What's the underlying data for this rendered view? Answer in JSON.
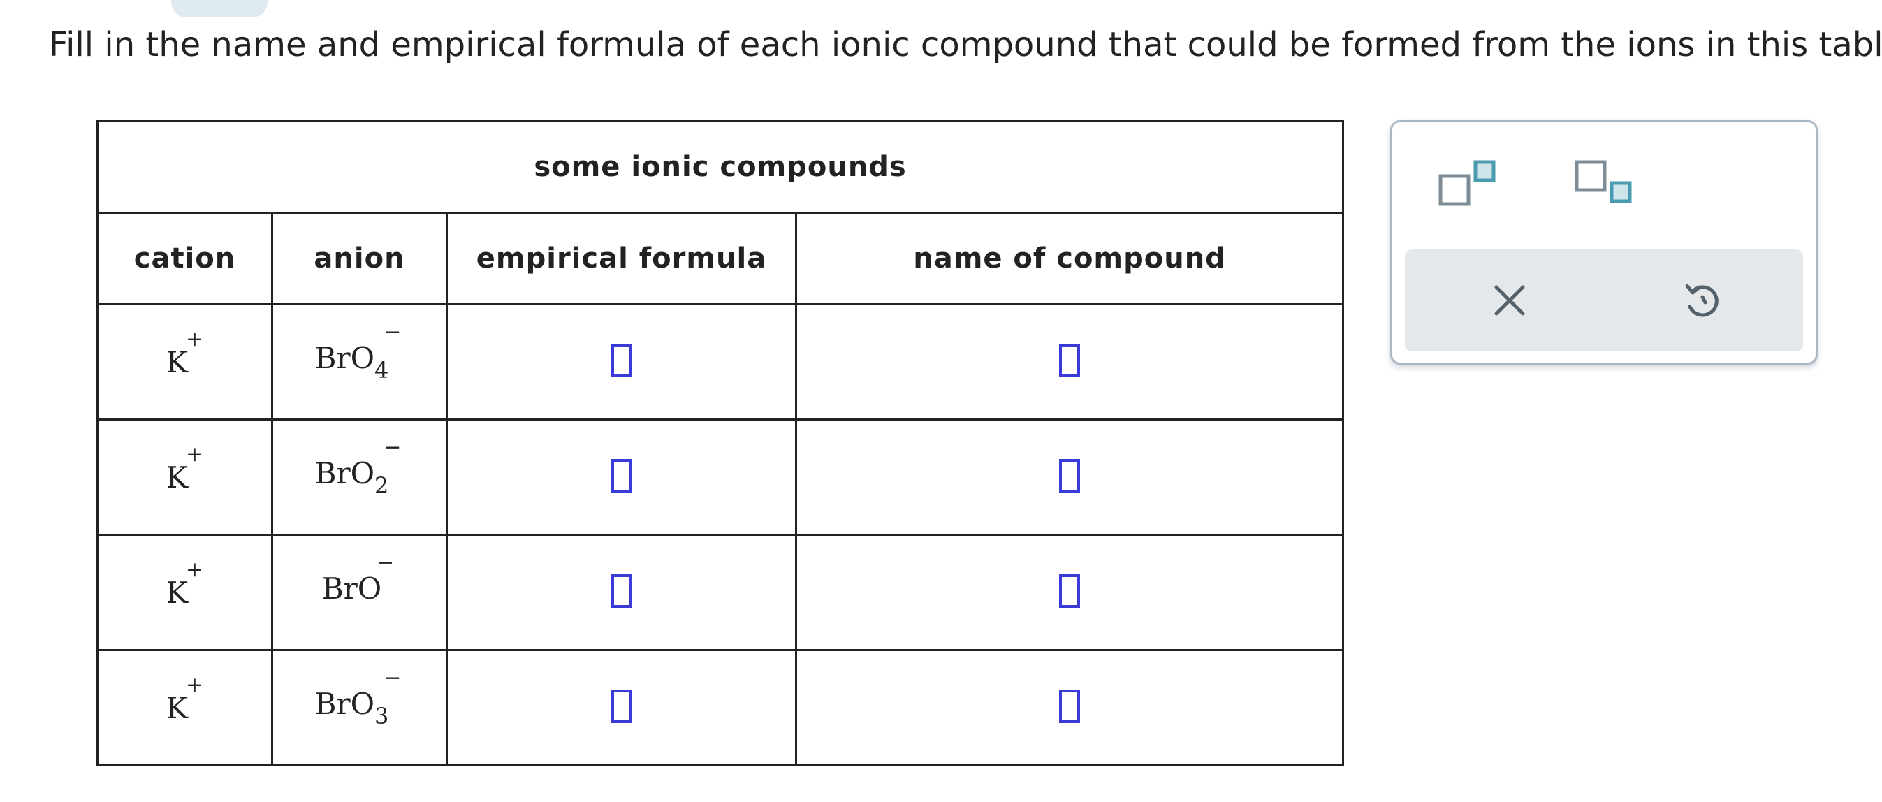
{
  "instructions": "Fill in the name and empirical formula of each ionic compound that could be formed from the ions in this table:",
  "table": {
    "caption": "some ionic compounds",
    "headers": {
      "cation": "cation",
      "anion": "anion",
      "formula": "empirical formula",
      "name": "name of compound"
    },
    "rows": [
      {
        "cation": "K",
        "cation_charge": "+",
        "anion": "BrO",
        "anion_sub": "4",
        "anion_charge": "−"
      },
      {
        "cation": "K",
        "cation_charge": "+",
        "anion": "BrO",
        "anion_sub": "2",
        "anion_charge": "−"
      },
      {
        "cation": "K",
        "cation_charge": "+",
        "anion": "BrO",
        "anion_sub": "",
        "anion_charge": "−"
      },
      {
        "cation": "K",
        "cation_charge": "+",
        "anion": "BrO",
        "anion_sub": "3",
        "anion_charge": "−"
      }
    ]
  },
  "palette": {
    "buttons": [
      "superscript-icon",
      "subscript-icon"
    ],
    "actions": [
      "clear-icon",
      "undo-icon"
    ],
    "colors": {
      "accent": "#3b3bd9",
      "icon_teal": "#4a9bb0",
      "icon_gray": "#7d8c96"
    }
  }
}
